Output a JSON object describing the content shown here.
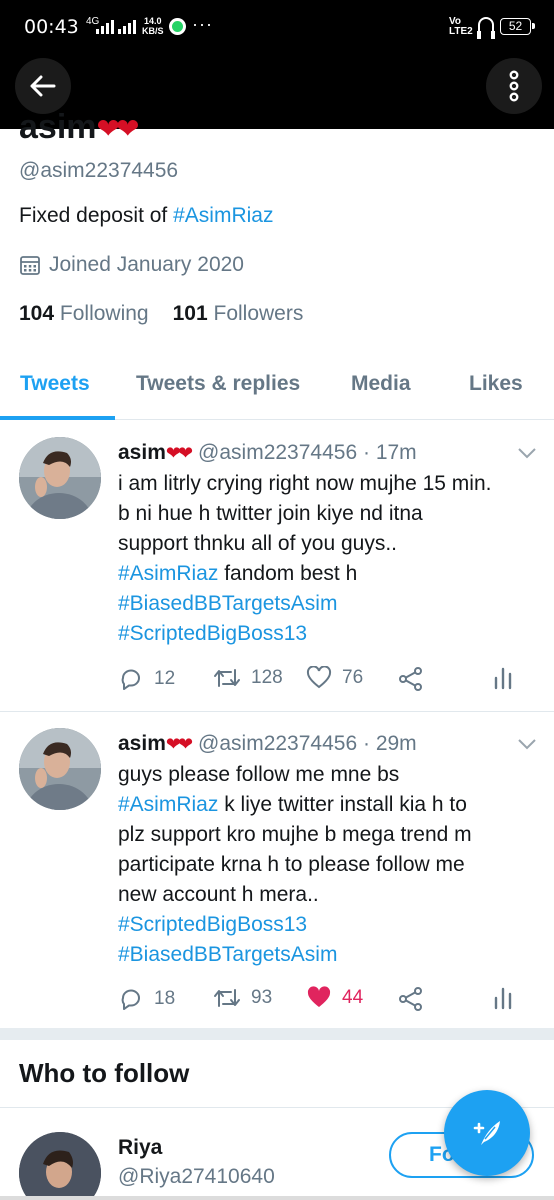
{
  "status_bar": {
    "time": "00:43",
    "network": "4G",
    "speed_value": "14.0",
    "speed_unit": "KB/S",
    "overflow": "···",
    "volte_top": "Vo",
    "volte_bottom": "LTE2",
    "battery": "52"
  },
  "profile": {
    "name": "asim",
    "name_hearts": "❤❤",
    "handle": "@asim22374456",
    "bio_prefix": "Fixed deposit of ",
    "bio_hashtag": "#AsimRiaz",
    "joined": "Joined January 2020",
    "following_count": "104",
    "following_label": "Following",
    "followers_count": "101",
    "followers_label": "Followers"
  },
  "tabs": [
    {
      "label": "Tweets",
      "active": true
    },
    {
      "label": "Tweets & replies",
      "active": false
    },
    {
      "label": "Media",
      "active": false
    },
    {
      "label": "Likes",
      "active": false
    }
  ],
  "tweets": [
    {
      "name": "asim",
      "hearts": "❤❤",
      "handle": "@asim22374456",
      "sep": "·",
      "time": "17m",
      "lines": [
        {
          "text": "i am litrly crying right now mujhe 15 min."
        },
        {
          "text": "b ni hue h twitter join kiye nd itna"
        },
        {
          "text": "support thnku all of you guys.."
        },
        {
          "hashtag": "#AsimRiaz",
          "text": " fandom best h"
        },
        {
          "hashtag": "#BiasedBBTargetsAsim"
        },
        {
          "hashtag": "#ScriptedBigBoss13"
        }
      ],
      "replies": "12",
      "retweets": "128",
      "likes": "76",
      "liked": false
    },
    {
      "name": "asim",
      "hearts": "❤❤",
      "handle": "@asim22374456",
      "sep": "·",
      "time": "29m",
      "lines": [
        {
          "text": "guys please follow me mne bs"
        },
        {
          "hashtag": "#AsimRiaz",
          "text": " k liye twitter install kia h to"
        },
        {
          "text": "plz support kro mujhe b mega trend m"
        },
        {
          "text": "participate krna h to please follow me"
        },
        {
          "text": "new account h mera.."
        },
        {
          "hashtag": "#ScriptedBigBoss13"
        },
        {
          "hashtag": "#BiasedBBTargetsAsim"
        }
      ],
      "replies": "18",
      "retweets": "93",
      "likes": "44",
      "liked": true
    }
  ],
  "who_to_follow": {
    "title": "Who to follow",
    "user_name": "Riya",
    "user_handle": "@Riya27410640",
    "follow_label": "Fo"
  },
  "colors": {
    "accent": "#1da1f2",
    "link": "#1b95e0",
    "like": "#e0245e",
    "muted": "#657786"
  }
}
